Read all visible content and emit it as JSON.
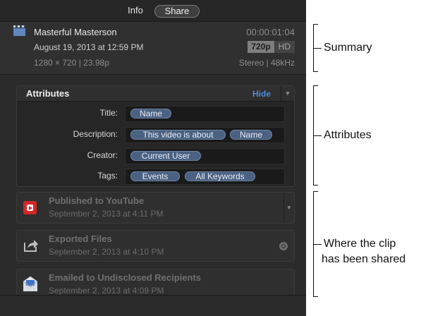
{
  "tabs": [
    {
      "label": "Info"
    },
    {
      "label": "Share"
    }
  ],
  "summary": {
    "clip_name": "Masterful Masterson",
    "date": "August 19, 2013 at 12:59 PM",
    "resolution": "1280 × 720  |  23.98p",
    "duration": "00:00:01:04",
    "format_badges": [
      "720p",
      "HD"
    ],
    "audio": "Stereo  |  48kHz",
    "icon": "clapper-icon"
  },
  "attributes": {
    "title": "Attributes",
    "hide_label": "Hide",
    "rows": [
      {
        "label": "Title:",
        "tokens": [
          "Name"
        ]
      },
      {
        "label": "Description:",
        "tokens": [
          "This video is about",
          "Name"
        ]
      },
      {
        "label": "Creator:",
        "tokens": [
          "Current User"
        ]
      },
      {
        "label": "Tags:",
        "tokens": [
          "Events",
          "All Keywords"
        ]
      }
    ]
  },
  "share_history": [
    {
      "title": "Published to YouTube",
      "date": "September 2, 2013 at 4:11 PM",
      "icon": "youtube-icon"
    },
    {
      "title": "Exported Files",
      "date": "September 2, 2013 at 4:10 PM",
      "icon": "share-export-icon"
    },
    {
      "title": "Emailed to Undisclosed Recipients",
      "date": "September 2, 2013 at 4:09 PM",
      "icon": "mail-icon"
    }
  ],
  "callouts": {
    "summary": "Summary",
    "attributes": "Attributes",
    "shared_line1": "Where the clip",
    "shared_line2": "has been shared"
  },
  "colors": {
    "panel_bg": "#2b2b2b",
    "token_bg": "#4a6182",
    "hide_link": "#4f8be2",
    "youtube_red": "#d42626"
  }
}
